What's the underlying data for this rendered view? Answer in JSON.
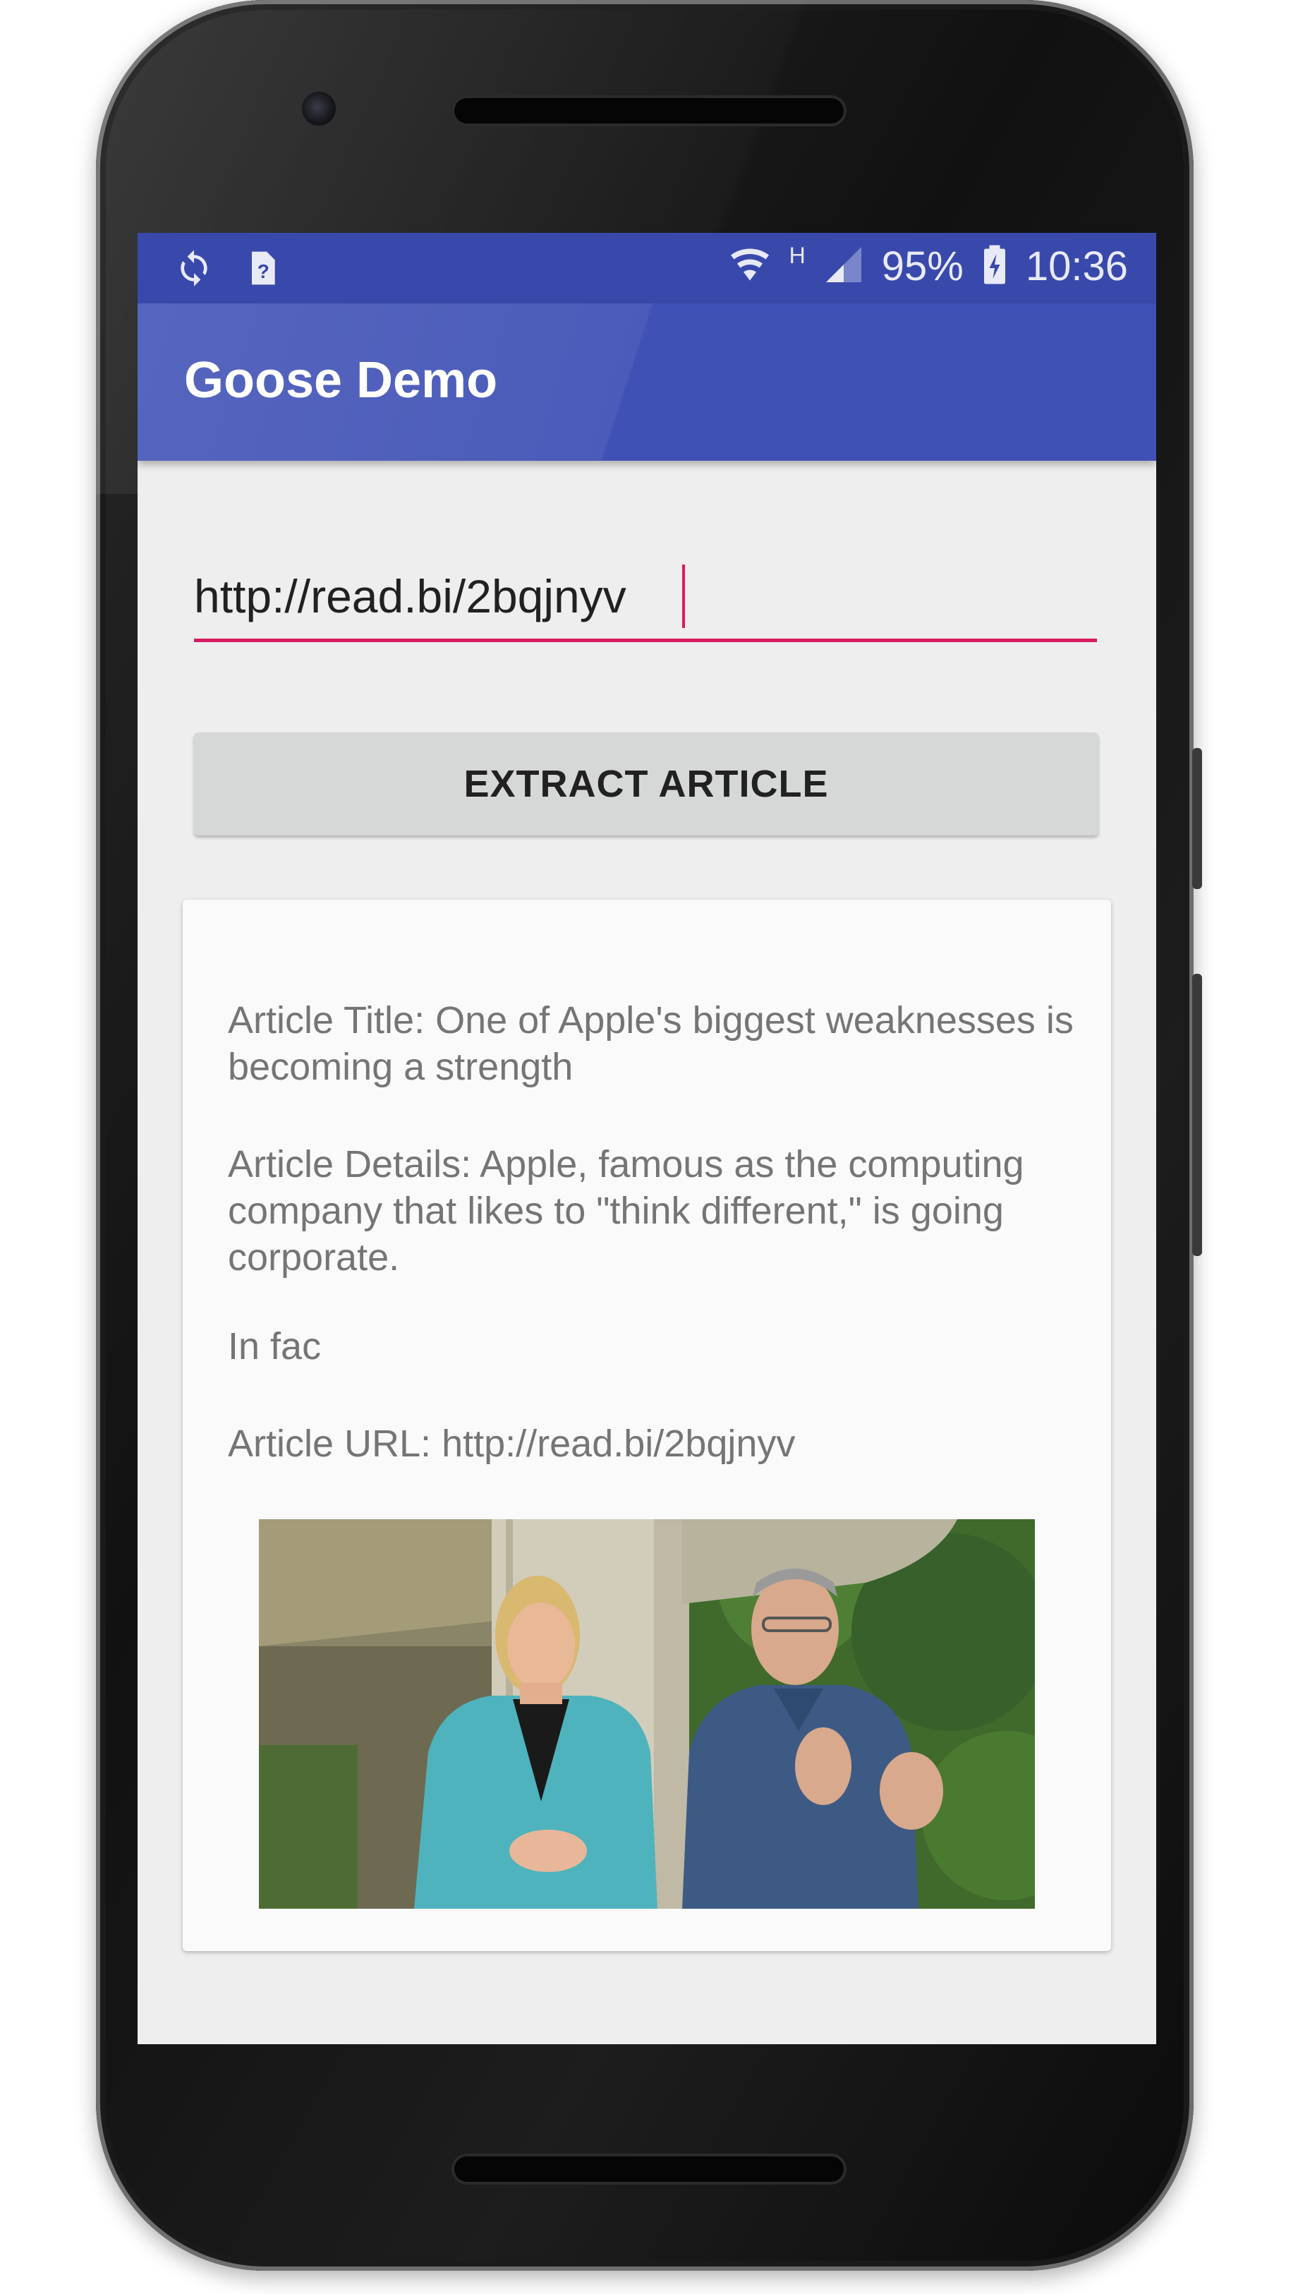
{
  "status_bar": {
    "battery": "95%",
    "time": "10:36",
    "network_type": "H",
    "icons": [
      "sync-icon",
      "unknown-notification-icon",
      "wifi-icon",
      "signal-icon",
      "battery-charging-icon"
    ]
  },
  "app_bar": {
    "title": "Goose Demo",
    "color": "#3f51b5"
  },
  "form": {
    "url_value": "http://read.bi/2bqjnyv",
    "accent_color": "#d81b60",
    "extract_button_label": "EXTRACT ARTICLE"
  },
  "article": {
    "title_line": "Article Title: One of Apple's biggest weaknesses is becoming a strength",
    "details_line": "Article Details: Apple, famous as the computing company that likes to \"think different,\" is going corporate.",
    "snippet": "In fac",
    "url_line": "Article URL: http://read.bi/2bqjnyv",
    "image_icon": "article-photo"
  }
}
